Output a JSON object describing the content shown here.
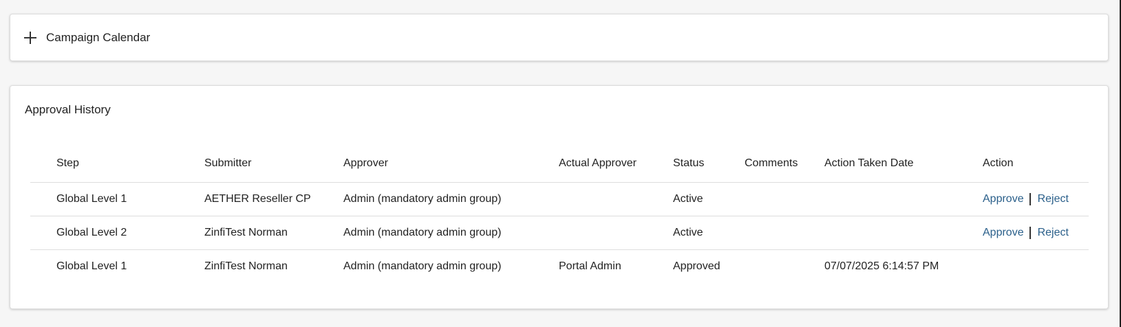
{
  "calendar": {
    "title": "Campaign Calendar"
  },
  "approval": {
    "title": "Approval History",
    "columns": [
      "Step",
      "Submitter",
      "Approver",
      "Actual Approver",
      "Status",
      "Comments",
      "Action Taken Date",
      "Action"
    ],
    "rows": [
      {
        "step": "Global Level 1",
        "submitter": "AETHER Reseller CP",
        "approver": "Admin (mandatory admin group)",
        "actual_approver": "",
        "status": "Active",
        "comments": "",
        "date": "",
        "approve_label": "Approve",
        "reject_label": "Reject"
      },
      {
        "step": "Global Level 2",
        "submitter": "ZinfiTest Norman",
        "approver": "Admin (mandatory admin group)",
        "actual_approver": "",
        "status": "Active",
        "comments": "",
        "date": "",
        "approve_label": "Approve",
        "reject_label": "Reject"
      },
      {
        "step": "Global Level 1",
        "submitter": "ZinfiTest Norman",
        "approver": "Admin (mandatory admin group)",
        "actual_approver": "Portal Admin",
        "status": "Approved",
        "comments": "",
        "date": "07/07/2025 6:14:57 PM",
        "approve_label": "",
        "reject_label": ""
      }
    ]
  },
  "colors": {
    "link": "#2a5f8a",
    "background": "#f6f6f6",
    "panel": "#ffffff"
  }
}
